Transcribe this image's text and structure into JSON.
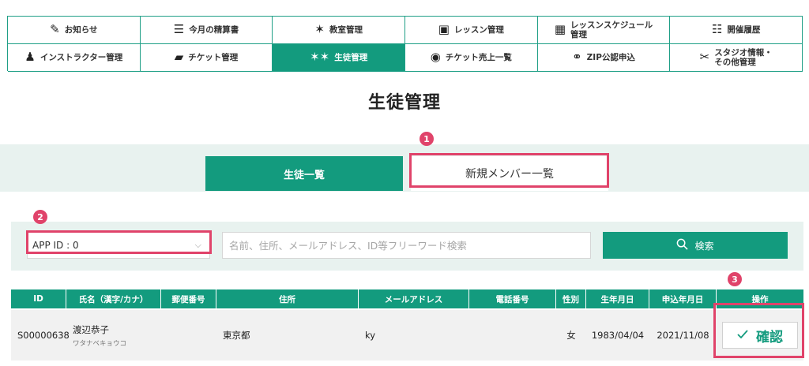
{
  "nav": {
    "items": [
      {
        "label": "お知らせ",
        "icon": "edit-note-icon",
        "glyph": "✎"
      },
      {
        "label": "今月の精算書",
        "icon": "document-icon",
        "glyph": "☰"
      },
      {
        "label": "教室管理",
        "icon": "person-jump-icon",
        "glyph": "✶"
      },
      {
        "label": "レッスン管理",
        "icon": "lesson-board-icon",
        "glyph": "▣"
      },
      {
        "label": "レッスンスケジュール\n管理",
        "icon": "calendar-icon",
        "glyph": "▦"
      },
      {
        "label": "開催履歴",
        "icon": "checklist-icon",
        "glyph": "☷"
      },
      {
        "label": "インストラクター管理",
        "icon": "instructor-icon",
        "glyph": "♟"
      },
      {
        "label": "チケット管理",
        "icon": "ticket-icon",
        "glyph": "▰"
      },
      {
        "label": "生徒管理",
        "icon": "students-icon",
        "glyph": "✶✶",
        "active": true
      },
      {
        "label": "チケット売上一覧",
        "icon": "ticket-sales-icon",
        "glyph": "◉"
      },
      {
        "label": "ZIP公認申込",
        "icon": "handshake-icon",
        "glyph": "⚭"
      },
      {
        "label": "スタジオ情報・\nその他管理",
        "icon": "tools-icon",
        "glyph": "✂"
      }
    ]
  },
  "page_title": "生徒管理",
  "tabs": {
    "students": "生徒一覧",
    "new_members": "新規メンバー一覧"
  },
  "filter": {
    "app_id_value": "APP ID : 0",
    "search_placeholder": "名前、住所、メールアドレス、ID等フリーワード検索",
    "search_button": "検索"
  },
  "table": {
    "headers": [
      "ID",
      "氏名（漢字/カナ）",
      "郵便番号",
      "住所",
      "メールアドレス",
      "電話番号",
      "性別",
      "生年月日",
      "申込年月日",
      "操作"
    ],
    "rows": [
      {
        "id": "S00000638",
        "name": "渡辺恭子",
        "kana": "ワタナベキョウコ",
        "postal": "",
        "address": "東京都",
        "email": "ky",
        "phone": "",
        "gender": "女",
        "birth": "1983/04/04",
        "applied": "2021/11/08",
        "action": "確認"
      }
    ]
  },
  "annotations": {
    "badge1": "1",
    "badge2": "2",
    "badge3": "3",
    "color": "#e0436a"
  },
  "colors": {
    "accent": "#139b7e",
    "panel": "#e8f2ef"
  }
}
